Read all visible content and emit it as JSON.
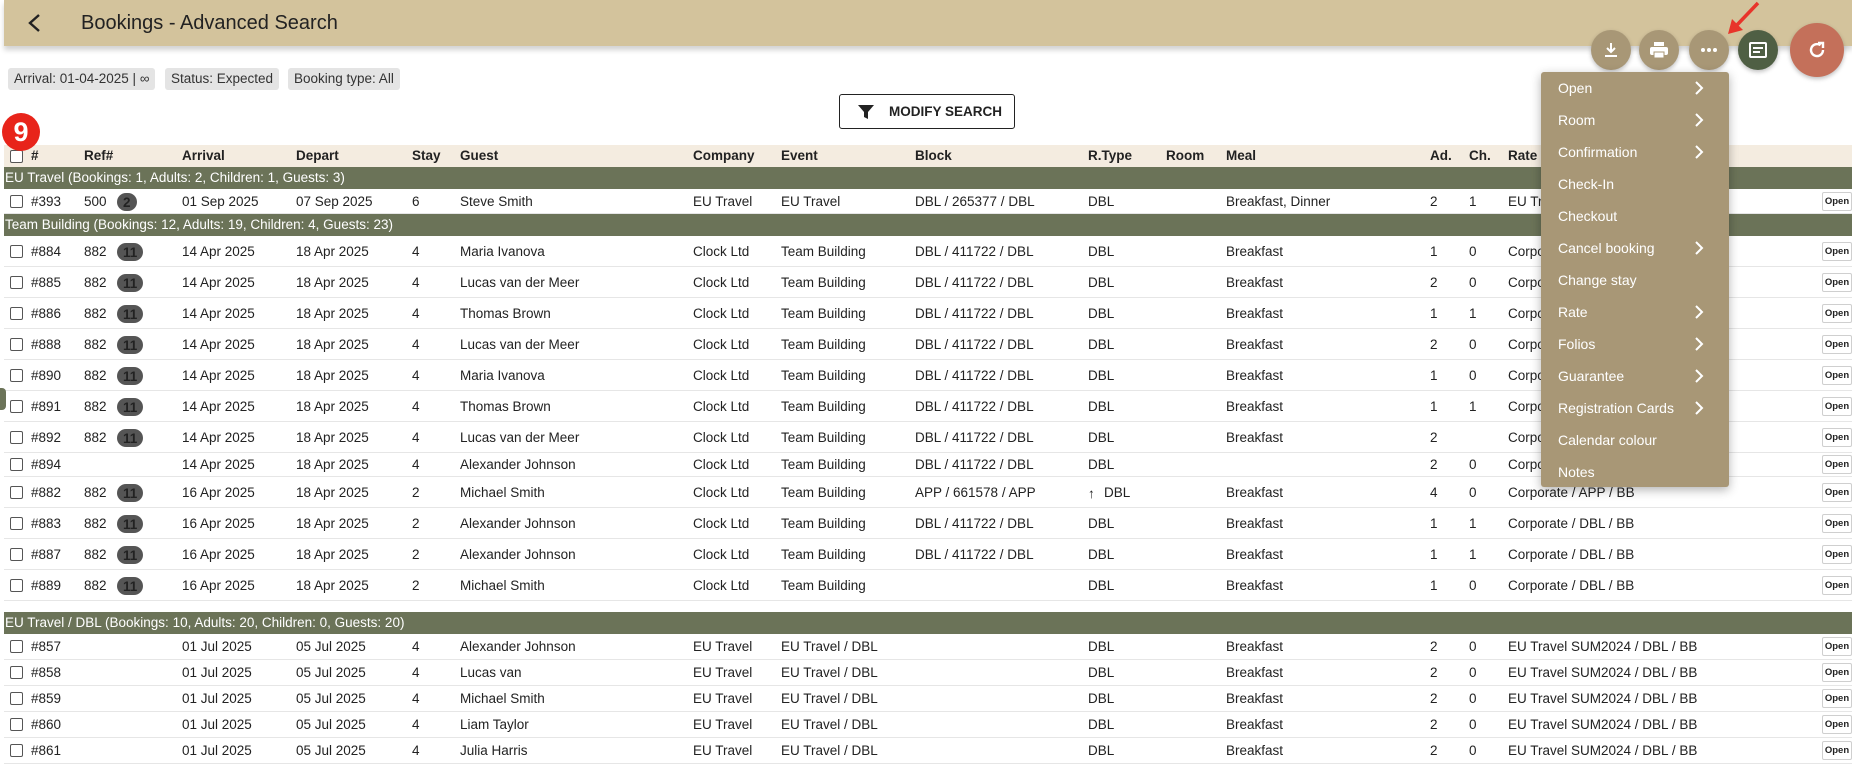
{
  "header": {
    "title": "Bookings - Advanced Search"
  },
  "filters": [
    "Arrival: 01-04-2025 | ∞",
    "Status: Expected",
    "Booking type: All"
  ],
  "modify_search": "MODIFY SEARCH",
  "step_badge": "9",
  "columns": [
    "#",
    "Ref#",
    "Arrival",
    "Depart",
    "Stay",
    "Guest",
    "Company",
    "Event",
    "Block",
    "R.Type",
    "Room",
    "Meal",
    "Ad.",
    "Ch.",
    "Rate"
  ],
  "groups": [
    {
      "label": "EU Travel (Bookings: 1, Adults: 2, Children: 1, Guests: 3)"
    },
    {
      "label": "Team Building (Bookings: 12, Adults: 19, Children: 4, Guests: 23)"
    },
    {
      "label": "EU Travel / DBL (Bookings: 10, Adults: 20, Children: 0, Guests: 20)"
    }
  ],
  "rows": [
    {
      "num": "#393",
      "ref": "500",
      "badge": "2",
      "arrival": "01 Sep 2025",
      "depart": "07 Sep 2025",
      "stay": "6",
      "guest": "Steve Smith",
      "company": "EU Travel",
      "event": "EU Travel",
      "block": "DBL / 265377 / DBL",
      "rtype": "DBL",
      "room": "",
      "meal": "Breakfast, Dinner",
      "ad": "2",
      "ch": "1",
      "rate": "EU Tr",
      "open": "Open"
    },
    {
      "num": "#884",
      "ref": "882",
      "badge": "11",
      "arrival": "14 Apr 2025",
      "depart": "18 Apr 2025",
      "stay": "4",
      "guest": "Maria Ivanova",
      "company": "Clock Ltd",
      "event": "Team Building",
      "block": "DBL / 411722 / DBL",
      "rtype": "DBL",
      "room": "",
      "meal": "Breakfast",
      "ad": "1",
      "ch": "0",
      "rate": "Corpo",
      "open": "Open"
    },
    {
      "num": "#885",
      "ref": "882",
      "badge": "11",
      "arrival": "14 Apr 2025",
      "depart": "18 Apr 2025",
      "stay": "4",
      "guest": "Lucas van der Meer",
      "company": "Clock Ltd",
      "event": "Team Building",
      "block": "DBL / 411722 / DBL",
      "rtype": "DBL",
      "room": "",
      "meal": "Breakfast",
      "ad": "2",
      "ch": "0",
      "rate": "Corpo",
      "open": "Open"
    },
    {
      "num": "#886",
      "ref": "882",
      "badge": "11",
      "arrival": "14 Apr 2025",
      "depart": "18 Apr 2025",
      "stay": "4",
      "guest": "Thomas Brown",
      "company": "Clock Ltd",
      "event": "Team Building",
      "block": "DBL / 411722 / DBL",
      "rtype": "DBL",
      "room": "",
      "meal": "Breakfast",
      "ad": "1",
      "ch": "1",
      "rate": "Corpo",
      "open": "Open"
    },
    {
      "num": "#888",
      "ref": "882",
      "badge": "11",
      "arrival": "14 Apr 2025",
      "depart": "18 Apr 2025",
      "stay": "4",
      "guest": "Lucas van der Meer",
      "company": "Clock Ltd",
      "event": "Team Building",
      "block": "DBL / 411722 / DBL",
      "rtype": "DBL",
      "room": "",
      "meal": "Breakfast",
      "ad": "2",
      "ch": "0",
      "rate": "Corpo",
      "open": "Open"
    },
    {
      "num": "#890",
      "ref": "882",
      "badge": "11",
      "arrival": "14 Apr 2025",
      "depart": "18 Apr 2025",
      "stay": "4",
      "guest": "Maria Ivanova",
      "company": "Clock Ltd",
      "event": "Team Building",
      "block": "DBL / 411722 / DBL",
      "rtype": "DBL",
      "room": "",
      "meal": "Breakfast",
      "ad": "1",
      "ch": "0",
      "rate": "Corpo",
      "open": "Open"
    },
    {
      "num": "#891",
      "ref": "882",
      "badge": "11",
      "arrival": "14 Apr 2025",
      "depart": "18 Apr 2025",
      "stay": "4",
      "guest": "Thomas Brown",
      "company": "Clock Ltd",
      "event": "Team Building",
      "block": "DBL / 411722 / DBL",
      "rtype": "DBL",
      "room": "",
      "meal": "Breakfast",
      "ad": "1",
      "ch": "1",
      "rate": "Corpo",
      "open": "Open"
    },
    {
      "num": "#892",
      "ref": "882",
      "badge": "11",
      "arrival": "14 Apr 2025",
      "depart": "18 Apr 2025",
      "stay": "4",
      "guest": "Lucas van der Meer",
      "company": "Clock Ltd",
      "event": "Team Building",
      "block": "DBL / 411722 / DBL",
      "rtype": "DBL",
      "room": "",
      "meal": "Breakfast",
      "ad": "2",
      "ch": "",
      "rate": "Corpo",
      "open": "Open"
    },
    {
      "num": "#894",
      "ref": "",
      "badge": "",
      "arrival": "14 Apr 2025",
      "depart": "18 Apr 2025",
      "stay": "4",
      "guest": "Alexander Johnson",
      "company": "Clock Ltd",
      "event": "Team Building",
      "block": "DBL / 411722 / DBL",
      "rtype": "DBL",
      "room": "",
      "meal": "",
      "ad": "2",
      "ch": "0",
      "rate": "Corpo",
      "open": "Open"
    },
    {
      "num": "#882",
      "ref": "882",
      "badge": "11",
      "arrival": "16 Apr 2025",
      "depart": "18 Apr 2025",
      "stay": "2",
      "guest": "Michael Smith",
      "company": "Clock Ltd",
      "event": "Team Building",
      "block": "APP / 661578 / APP",
      "rtype": "DBL",
      "upgrade": true,
      "room": "",
      "meal": "Breakfast",
      "ad": "4",
      "ch": "0",
      "rate": "Corporate / APP / BB",
      "open": "Open"
    },
    {
      "num": "#883",
      "ref": "882",
      "badge": "11",
      "arrival": "16 Apr 2025",
      "depart": "18 Apr 2025",
      "stay": "2",
      "guest": "Alexander Johnson",
      "company": "Clock Ltd",
      "event": "Team Building",
      "block": "DBL / 411722 / DBL",
      "rtype": "DBL",
      "room": "",
      "meal": "Breakfast",
      "ad": "1",
      "ch": "1",
      "rate": "Corporate / DBL / BB",
      "open": "Open"
    },
    {
      "num": "#887",
      "ref": "882",
      "badge": "11",
      "arrival": "16 Apr 2025",
      "depart": "18 Apr 2025",
      "stay": "2",
      "guest": "Alexander Johnson",
      "company": "Clock Ltd",
      "event": "Team Building",
      "block": "DBL / 411722 / DBL",
      "rtype": "DBL",
      "room": "",
      "meal": "Breakfast",
      "ad": "1",
      "ch": "1",
      "rate": "Corporate / DBL / BB",
      "open": "Open"
    },
    {
      "num": "#889",
      "ref": "882",
      "badge": "11",
      "arrival": "16 Apr 2025",
      "depart": "18 Apr 2025",
      "stay": "2",
      "guest": "Michael Smith",
      "company": "Clock Ltd",
      "event": "Team Building",
      "block": "",
      "rtype": "DBL",
      "room": "",
      "meal": "Breakfast",
      "ad": "1",
      "ch": "0",
      "rate": "Corporate / DBL / BB",
      "open": "Open"
    },
    {
      "num": "#857",
      "ref": "",
      "badge": "",
      "arrival": "01 Jul 2025",
      "depart": "05 Jul 2025",
      "stay": "4",
      "guest": "Alexander Johnson",
      "company": "EU Travel",
      "event": "EU Travel / DBL",
      "block": "",
      "rtype": "DBL",
      "room": "",
      "meal": "Breakfast",
      "ad": "2",
      "ch": "0",
      "rate": "EU Travel SUM2024 / DBL / BB",
      "open": "Open"
    },
    {
      "num": "#858",
      "ref": "",
      "badge": "",
      "arrival": "01 Jul 2025",
      "depart": "05 Jul 2025",
      "stay": "4",
      "guest": "Lucas van",
      "company": "EU Travel",
      "event": "EU Travel / DBL",
      "block": "",
      "rtype": "DBL",
      "room": "",
      "meal": "Breakfast",
      "ad": "2",
      "ch": "0",
      "rate": "EU Travel SUM2024 / DBL / BB",
      "open": "Open"
    },
    {
      "num": "#859",
      "ref": "",
      "badge": "",
      "arrival": "01 Jul 2025",
      "depart": "05 Jul 2025",
      "stay": "4",
      "guest": "Michael Smith",
      "company": "EU Travel",
      "event": "EU Travel / DBL",
      "block": "",
      "rtype": "DBL",
      "room": "",
      "meal": "Breakfast",
      "ad": "2",
      "ch": "0",
      "rate": "EU Travel SUM2024 / DBL / BB",
      "open": "Open"
    },
    {
      "num": "#860",
      "ref": "",
      "badge": "",
      "arrival": "01 Jul 2025",
      "depart": "05 Jul 2025",
      "stay": "4",
      "guest": "Liam Taylor",
      "company": "EU Travel",
      "event": "EU Travel / DBL",
      "block": "",
      "rtype": "DBL",
      "room": "",
      "meal": "Breakfast",
      "ad": "2",
      "ch": "0",
      "rate": "EU Travel SUM2024 / DBL / BB",
      "open": "Open"
    },
    {
      "num": "#861",
      "ref": "",
      "badge": "",
      "arrival": "01 Jul 2025",
      "depart": "05 Jul 2025",
      "stay": "4",
      "guest": "Julia Harris",
      "company": "EU Travel",
      "event": "EU Travel / DBL",
      "block": "",
      "rtype": "DBL",
      "room": "",
      "meal": "Breakfast",
      "ad": "2",
      "ch": "0",
      "rate": "EU Travel SUM2024 / DBL / BB",
      "open": "Open"
    }
  ],
  "menu": [
    {
      "label": "Open",
      "sub": true
    },
    {
      "label": "Room",
      "sub": true
    },
    {
      "label": "Confirmation",
      "sub": true
    },
    {
      "label": "Check-In",
      "sub": false
    },
    {
      "label": "Checkout",
      "sub": false
    },
    {
      "label": "Cancel booking",
      "sub": true
    },
    {
      "label": "Change stay",
      "sub": false
    },
    {
      "label": "Rate",
      "sub": true
    },
    {
      "label": "Folios",
      "sub": true
    },
    {
      "label": "Guarantee",
      "sub": true
    },
    {
      "label": "Registration Cards",
      "sub": true
    },
    {
      "label": "Calendar colour",
      "sub": false
    },
    {
      "label": "Notes",
      "sub": false
    }
  ],
  "colors": {
    "header_bg": "#d3c39c",
    "group_bg": "#6b7358",
    "menu_bg": "#a89776",
    "refresh": "#c4705a",
    "accent_arrow": "#e8342a"
  }
}
